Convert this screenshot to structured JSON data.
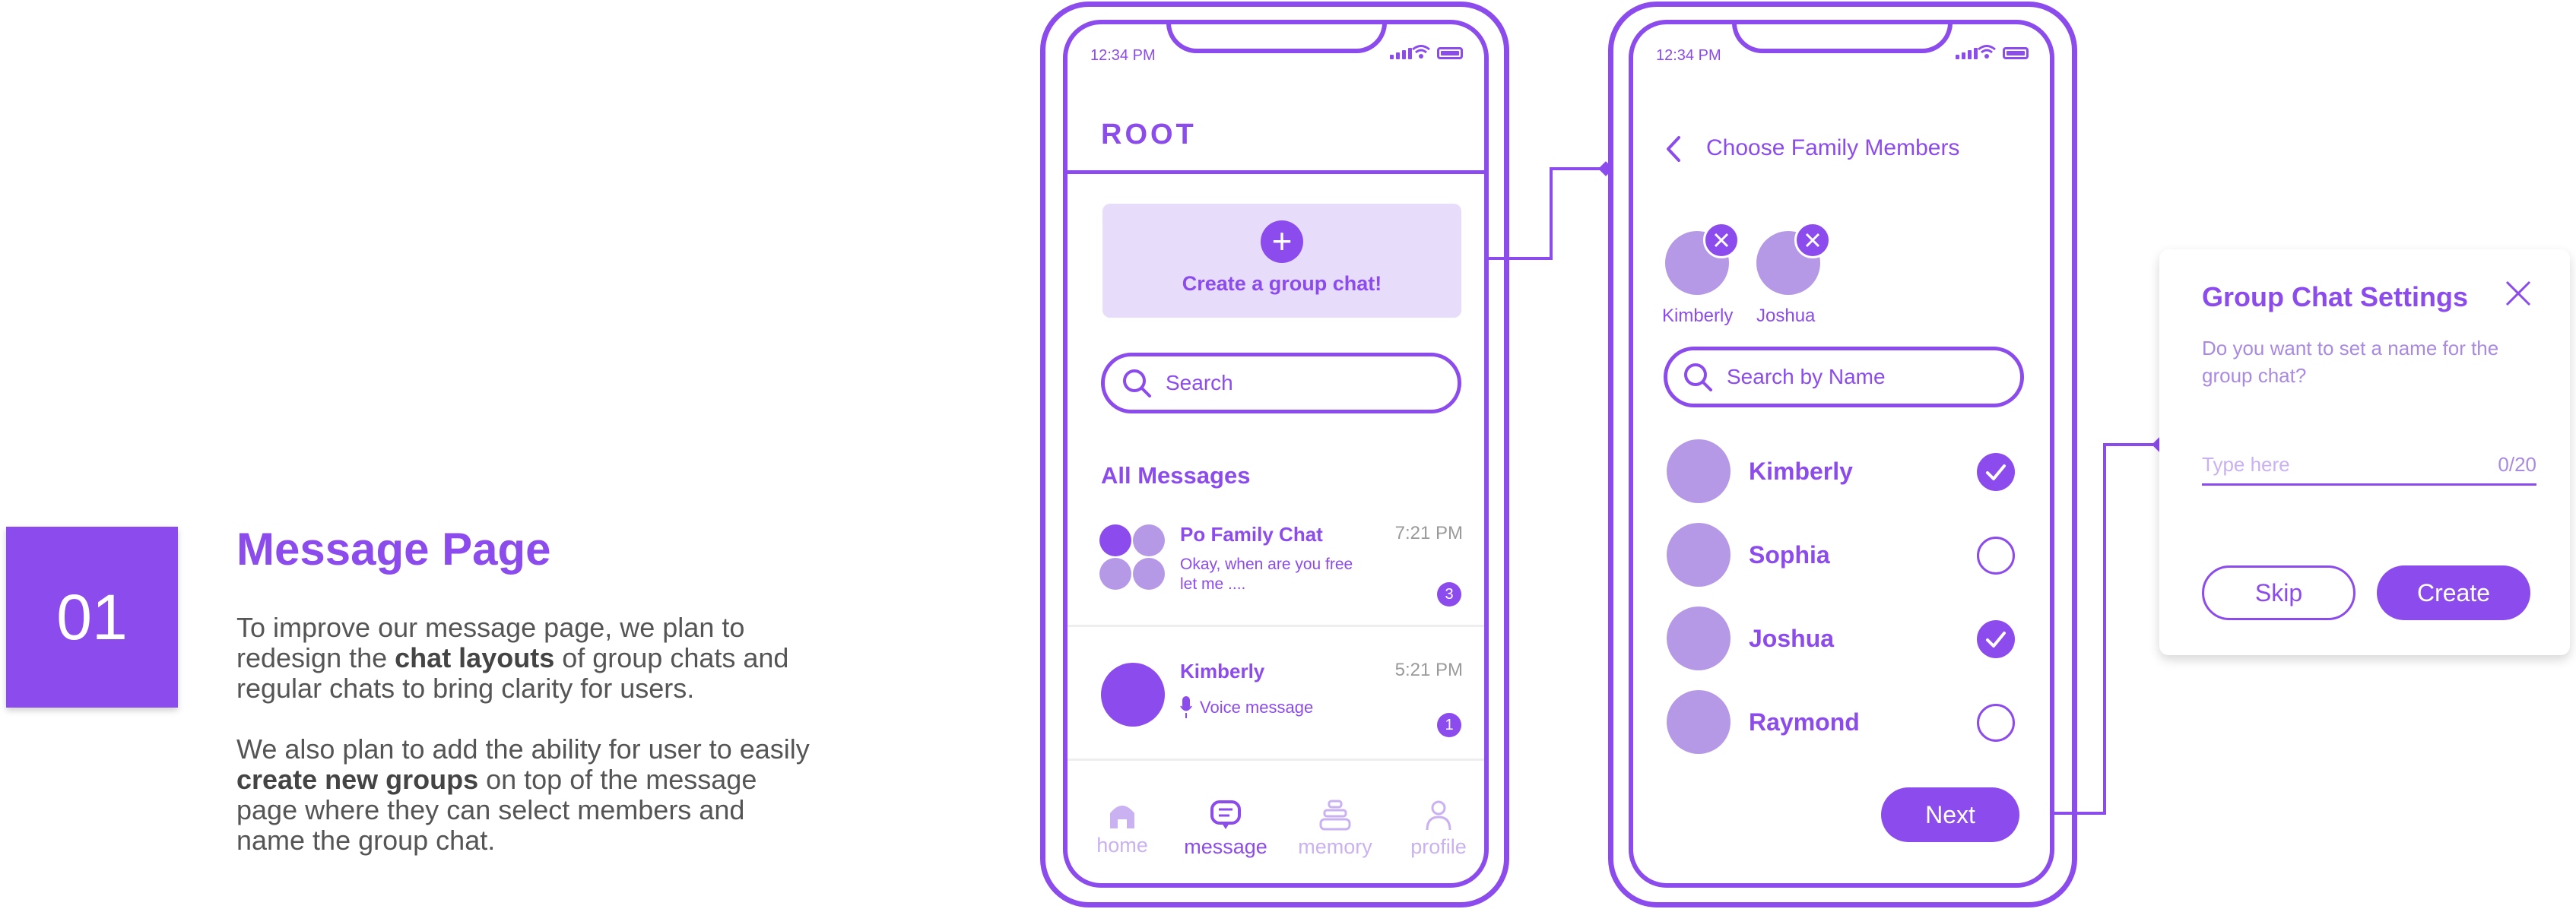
{
  "intro": {
    "number": "01",
    "title": "Message Page",
    "para1_a": "To improve our message page, we plan to",
    "para1_b_pre": "redesign the ",
    "para1_b_bold": "chat layouts",
    "para1_b_post": " of group chats and",
    "para1_c": "regular chats to bring clarity for users.",
    "para2_a": "We also plan to add the ability for user to easily",
    "para2_b_bold": "create new groups",
    "para2_b_post": " on top of the message",
    "para2_c": "page where they can select members and",
    "para2_d": "name the group chat."
  },
  "colors": {
    "accent": "#8c4bed",
    "accent_light": "#e8dcfb",
    "avatar": "#b699e6",
    "muted": "#c9b1f2"
  },
  "phone1": {
    "time": "12:34 PM",
    "app_title": "ROOT",
    "create_label": "Create a group chat!",
    "create_icon": "plus-icon",
    "search_placeholder": "Search",
    "section_title": "All Messages",
    "chats": [
      {
        "name": "Po Family Chat",
        "time": "7:21 PM",
        "preview_line1": "Okay, when are you free",
        "preview_line2": "let me ....",
        "unread": "3",
        "avatar": "group-avatar"
      },
      {
        "name": "Kimberly",
        "time": "5:21 PM",
        "preview": "Voice message",
        "preview_icon": "microphone-icon",
        "unread": "1",
        "avatar": "user-avatar"
      }
    ],
    "nav": [
      {
        "label": "home",
        "icon": "home-icon",
        "active": false
      },
      {
        "label": "message",
        "icon": "chat-bubble-icon",
        "active": true
      },
      {
        "label": "memory",
        "icon": "stack-icon",
        "active": false
      },
      {
        "label": "profile",
        "icon": "person-icon",
        "active": false
      }
    ]
  },
  "phone2": {
    "time": "12:34 PM",
    "back_icon": "chevron-left-icon",
    "title": "Choose Family Members",
    "selected": [
      {
        "name": "Kimberly"
      },
      {
        "name": "Joshua"
      }
    ],
    "search_placeholder": "Search by Name",
    "members": [
      {
        "name": "Kimberly",
        "checked": true
      },
      {
        "name": "Sophia",
        "checked": false
      },
      {
        "name": "Joshua",
        "checked": true
      },
      {
        "name": "Raymond",
        "checked": false
      }
    ],
    "next_label": "Next"
  },
  "dialog": {
    "title": "Group Chat Settings",
    "question": "Do you want to set a name for the group chat?",
    "question_line1": "Do you want to set a name for the",
    "question_line2": "group chat?",
    "input_placeholder": "Type here",
    "counter": "0/20",
    "skip_label": "Skip",
    "create_label": "Create",
    "close_icon": "close-icon"
  }
}
